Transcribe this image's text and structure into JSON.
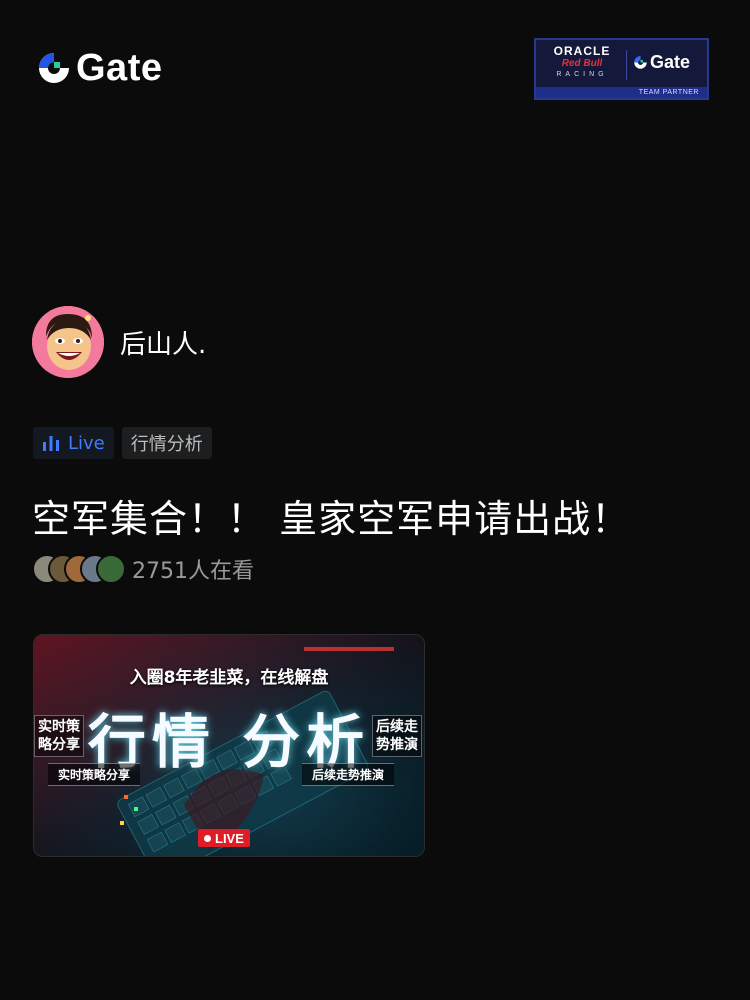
{
  "brand": {
    "name": "Gate",
    "accent_color": "#2354e6",
    "logo_icon": "gate-logo-icon"
  },
  "partner_banner": {
    "oracle": "ORACLE",
    "redbull": "Red Bull",
    "racing": "RACING",
    "gate": "Gate",
    "caption": "TEAM PARTNER"
  },
  "author": {
    "name": "后山人.",
    "avatar_icon": "cartoon-avatar"
  },
  "tags": {
    "live_label": "Live",
    "live_icon": "bar-chart-icon",
    "live_color": "#3f7cff",
    "category_label": "行情分析"
  },
  "post": {
    "title": "空军集合！！ 皇家空军申请出战！"
  },
  "viewers": {
    "count_text": "2751人在看",
    "avatar_colors": [
      "#8a8a7a",
      "#6b5a3a",
      "#a0693a",
      "#6a7a8a",
      "#3a6a3a"
    ]
  },
  "thumbnail": {
    "headline": "入圈8年老韭菜，在线解盘",
    "big_text": "行情 分析",
    "side_left": "实时策\n略分享",
    "side_right": "后续走\n势推演",
    "pill_left": "实时策略分享",
    "pill_right": "后续走势推演",
    "live_badge": "LIVE",
    "live_color": "#e01c26"
  }
}
